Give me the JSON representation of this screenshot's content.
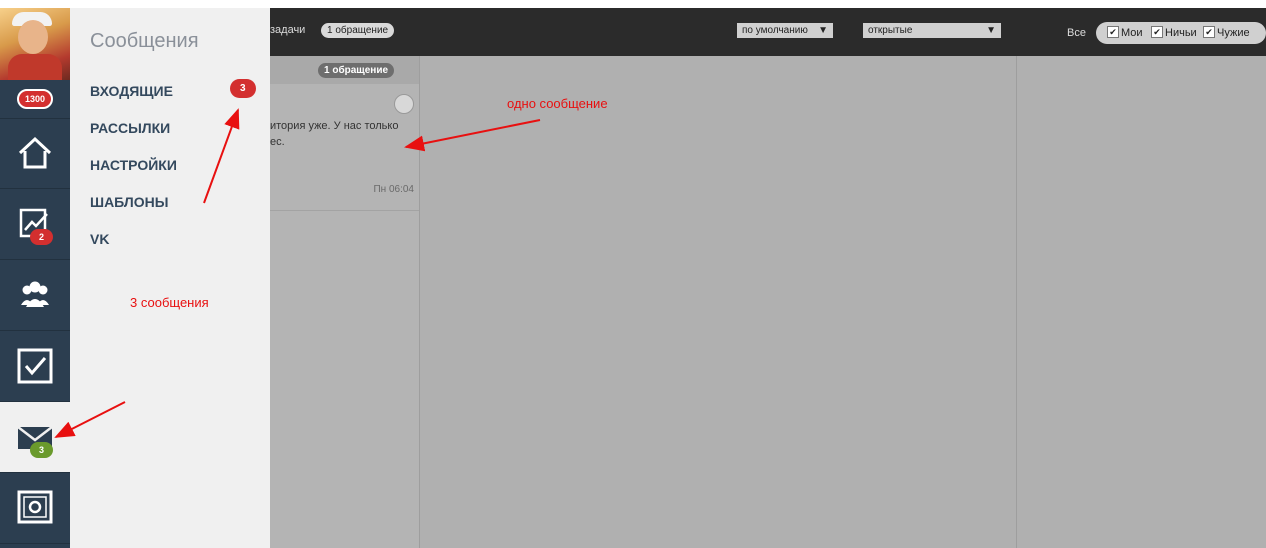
{
  "rail": {
    "avatar": "user-avatar",
    "counter": "1300",
    "items": [
      {
        "icon": "home-icon",
        "badge": ""
      },
      {
        "icon": "chart-icon",
        "badge": "2"
      },
      {
        "icon": "users-icon",
        "badge": ""
      },
      {
        "icon": "checkbox-icon",
        "badge": ""
      },
      {
        "icon": "mail-icon",
        "badge": "3",
        "active": true
      },
      {
        "icon": "safe-icon",
        "badge": ""
      }
    ]
  },
  "panel": {
    "title": "Сообщения",
    "items": [
      {
        "label": "ВХОДЯЩИЕ",
        "badge": "3"
      },
      {
        "label": "РАССЫЛКИ"
      },
      {
        "label": "НАСТРОЙКИ"
      },
      {
        "label": "ШАБЛОНЫ"
      },
      {
        "label": "VK"
      }
    ]
  },
  "topbar": {
    "tasks_label": "задачи",
    "tasks_chip": "1 обращение",
    "sort_select": "по умолчанию",
    "status_select": "открытые",
    "all_label": "Все",
    "filters": [
      "Мои",
      "Ничьи",
      "Чужие"
    ]
  },
  "list": {
    "header_chip": "1 обращение",
    "message": {
      "text": "итория уже. У нас только ес.",
      "time": "Пн 06:04"
    }
  },
  "annotations": {
    "one_message": "одно сообщение",
    "three_messages": "3 сообщения"
  },
  "colors": {
    "rail": "#2c3e50",
    "badge_red": "#d32f2f",
    "badge_green": "#6a9a2c",
    "annotation": "#e81010"
  }
}
